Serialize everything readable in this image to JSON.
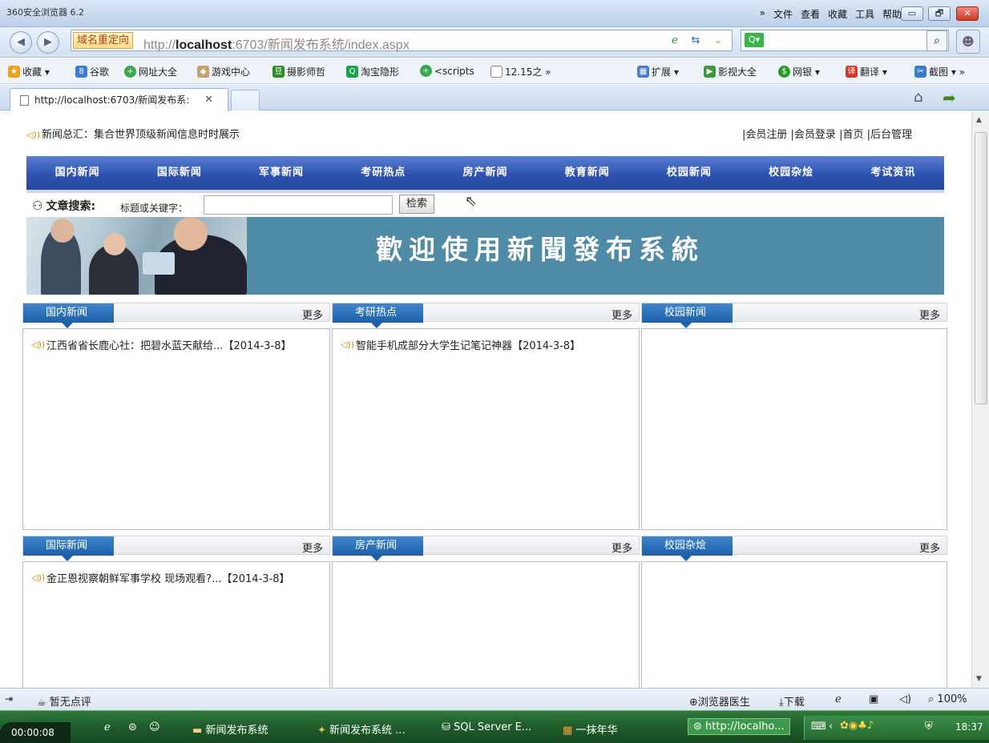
{
  "window": {
    "title": "360安全浏览器 6.2",
    "menu": [
      "»",
      "文件",
      "查看",
      "收藏",
      "工具",
      "帮助"
    ],
    "buttons": {
      "minimize": "▭",
      "restore": "🗗",
      "close": "✕"
    }
  },
  "address_bar": {
    "redirect_badge": "域名重定向",
    "url_prefix": "http://",
    "url_host": "localhost",
    "url_rest": ":6703/新闻发布系统/index.aspx"
  },
  "bookmarks": [
    {
      "label": "收藏 ▾",
      "color": "#f0a020",
      "icon": "★"
    },
    {
      "label": "谷歌",
      "color": "#3a7bd5",
      "icon": "8"
    },
    {
      "label": "网址大全",
      "color": "#3aa84a",
      "icon": "+"
    },
    {
      "label": "游戏中心",
      "color": "#8a6a3a",
      "icon": "🎮"
    },
    {
      "label": "摄影师哲",
      "color": "#2a8a2a",
      "icon": "豆"
    },
    {
      "label": "淘宝隐形",
      "color": "#1aa04a",
      "icon": "Q"
    },
    {
      "label": "<scripts",
      "color": "#3aa84a",
      "icon": "+"
    },
    {
      "label": "12.15之 »",
      "color": "#ffffff",
      "icon": ""
    }
  ],
  "bookmarks_right": [
    {
      "label": "扩展 ▾",
      "color": "#4a7bd0",
      "icon": "▦"
    },
    {
      "label": "影视大全",
      "color": "#3a9a3a",
      "icon": "▶"
    },
    {
      "label": "网银 ▾",
      "color": "#2a9a2a",
      "icon": "$"
    },
    {
      "label": "翻译 ▾",
      "color": "#d03a2a",
      "icon": "译"
    },
    {
      "label": "截图 ▾ »",
      "color": "#3a7bd0",
      "icon": "✂"
    }
  ],
  "tab": {
    "label": "http://localhost:6703/新闻发布系:",
    "close": "✕"
  },
  "site": {
    "header": "新闻总汇：集合世界顶级新闻信息时时展示",
    "links": [
      "|会员注册",
      "|会员登录",
      "|首页",
      "|后台管理"
    ],
    "nav": [
      "国内新闻",
      "国际新闻",
      "军事新闻",
      "考研热点",
      "房产新闻",
      "教育新闻",
      "校园新闻",
      "校园杂烩",
      "考试资讯"
    ],
    "search_label": "文章搜索:",
    "search_hint": "标题或关键字：",
    "search_value": "",
    "search_button": "检索",
    "banner_title": "歡迎使用新聞發布系統"
  },
  "panels": [
    {
      "title": "国内新闻",
      "more": "更多",
      "items": [
        {
          "text": "江西省省长鹿心社：把碧水蓝天献给...",
          "date": "【2014-3-8】"
        }
      ]
    },
    {
      "title": "考研热点",
      "more": "更多",
      "items": [
        {
          "text": "智能手机成部分大学生记笔记神器",
          "date": "【2014-3-8】"
        }
      ]
    },
    {
      "title": "校园新闻",
      "more": "更多",
      "items": []
    },
    {
      "title": "国际新闻",
      "more": "更多",
      "items": [
        {
          "text": "金正恩视察朝鲜军事学校 现场观看?...",
          "date": "【2014-3-8】"
        }
      ]
    },
    {
      "title": "房产新闻",
      "more": "更多",
      "items": []
    },
    {
      "title": "校园杂烩",
      "more": "更多",
      "items": []
    }
  ],
  "statusbar": {
    "comment": "暂无点评",
    "doctor": "浏览器医生",
    "download": "下载",
    "zoom": "100%"
  },
  "taskbar": {
    "rec_time": "00:00:08",
    "items": [
      "新闻发布系统",
      "新闻发布系统 ...",
      "SQL Server E...",
      "一抹年华",
      "http://localho..."
    ],
    "clock": "18:37"
  }
}
